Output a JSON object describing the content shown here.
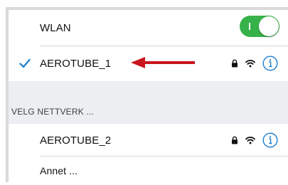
{
  "wlan": {
    "label": "WLAN",
    "toggle_on": true,
    "toggle_on_mark": "I",
    "toggle_color": "#37b24a"
  },
  "connected_network": {
    "name": "AEROTUBE_1",
    "selected_icon": "checkmark-icon",
    "secured_icon": "lock-icon",
    "signal_icon": "wifi-icon",
    "info_icon": "info-icon",
    "annotation_icon": "red-arrow-icon",
    "annotation_color": "#c8161d"
  },
  "section": {
    "header": "VELG NETTVERK ..."
  },
  "networks": [
    {
      "name": "AEROTUBE_2",
      "secured_icon": "lock-icon",
      "signal_icon": "wifi-icon",
      "info_icon": "info-icon"
    }
  ],
  "other": {
    "label": "Annet ..."
  },
  "colors": {
    "accent_blue": "#1a7fd0",
    "section_bg": "#eceef2",
    "frame_border": "#d9dadd"
  }
}
